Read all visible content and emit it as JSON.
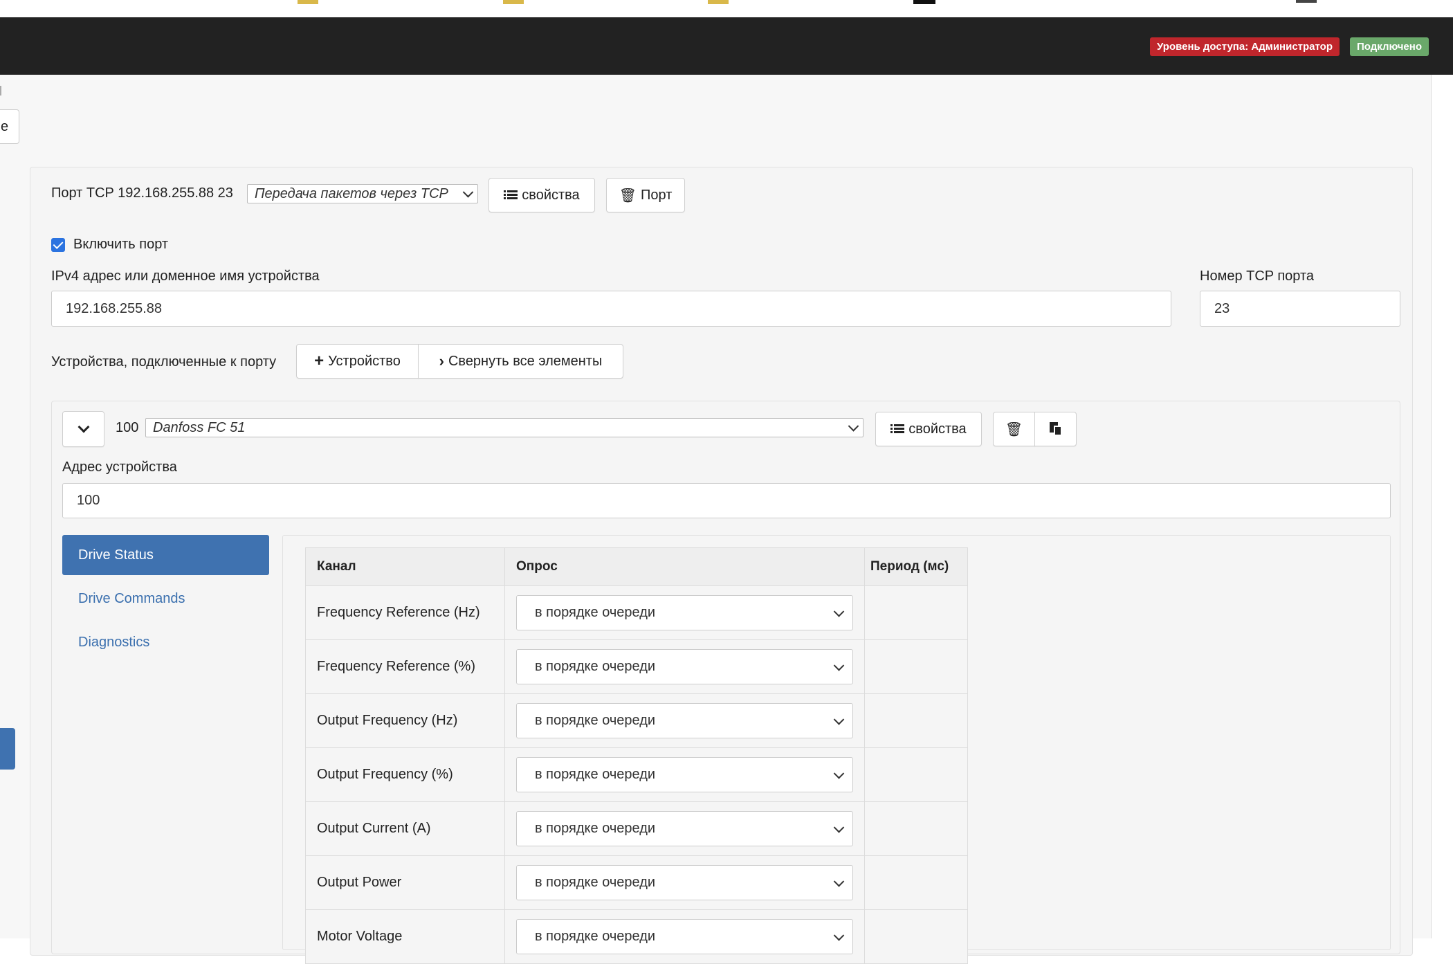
{
  "navbar": {
    "access_badge": "Уровень доступа: Администратор",
    "connection_badge": "Подключено",
    "access_color": "#c0262c",
    "connection_color": "#6aa86a"
  },
  "left_cut": {
    "button_text": "е"
  },
  "port": {
    "title": "Порт TCP 192.168.255.88 23",
    "protocol_value": "Передача пакетов через TCP",
    "properties_label": "свойства",
    "delete_label": "Порт",
    "enable_label": "Включить порт",
    "enable_checked": true,
    "host_label": "IPv4 адрес или доменное имя устройства",
    "host_value": "192.168.255.88",
    "tcp_port_label": "Номер TCP порта",
    "tcp_port_value": "23",
    "devices_label": "Устройства, подключенные к порту",
    "add_device_label": "Устройство",
    "collapse_label": "Свернуть все элементы"
  },
  "device": {
    "address_display": "100",
    "model_value": "Danfoss FC 51",
    "properties_label": "свойства",
    "address_label": "Адрес устройства",
    "address_value": "100"
  },
  "sections": [
    {
      "label": "Drive Status",
      "active": true
    },
    {
      "label": "Drive Commands",
      "active": false
    },
    {
      "label": "Diagnostics",
      "active": false
    }
  ],
  "table": {
    "headers": [
      "Канал",
      "Опрос",
      "Период (мс)"
    ],
    "rows": [
      {
        "channel": "Frequency Reference (Hz)",
        "poll": "в порядке очереди",
        "period": ""
      },
      {
        "channel": "Frequency Reference (%)",
        "poll": "в порядке очереди",
        "period": ""
      },
      {
        "channel": "Output Frequency (Hz)",
        "poll": "в порядке очереди",
        "period": ""
      },
      {
        "channel": "Output Frequency (%)",
        "poll": "в порядке очереди",
        "period": ""
      },
      {
        "channel": "Output Current (A)",
        "poll": "в порядке очереди",
        "period": ""
      },
      {
        "channel": "Output Power",
        "poll": "в порядке очереди",
        "period": ""
      },
      {
        "channel": "Motor Voltage",
        "poll": "в порядке очереди",
        "period": ""
      }
    ]
  }
}
